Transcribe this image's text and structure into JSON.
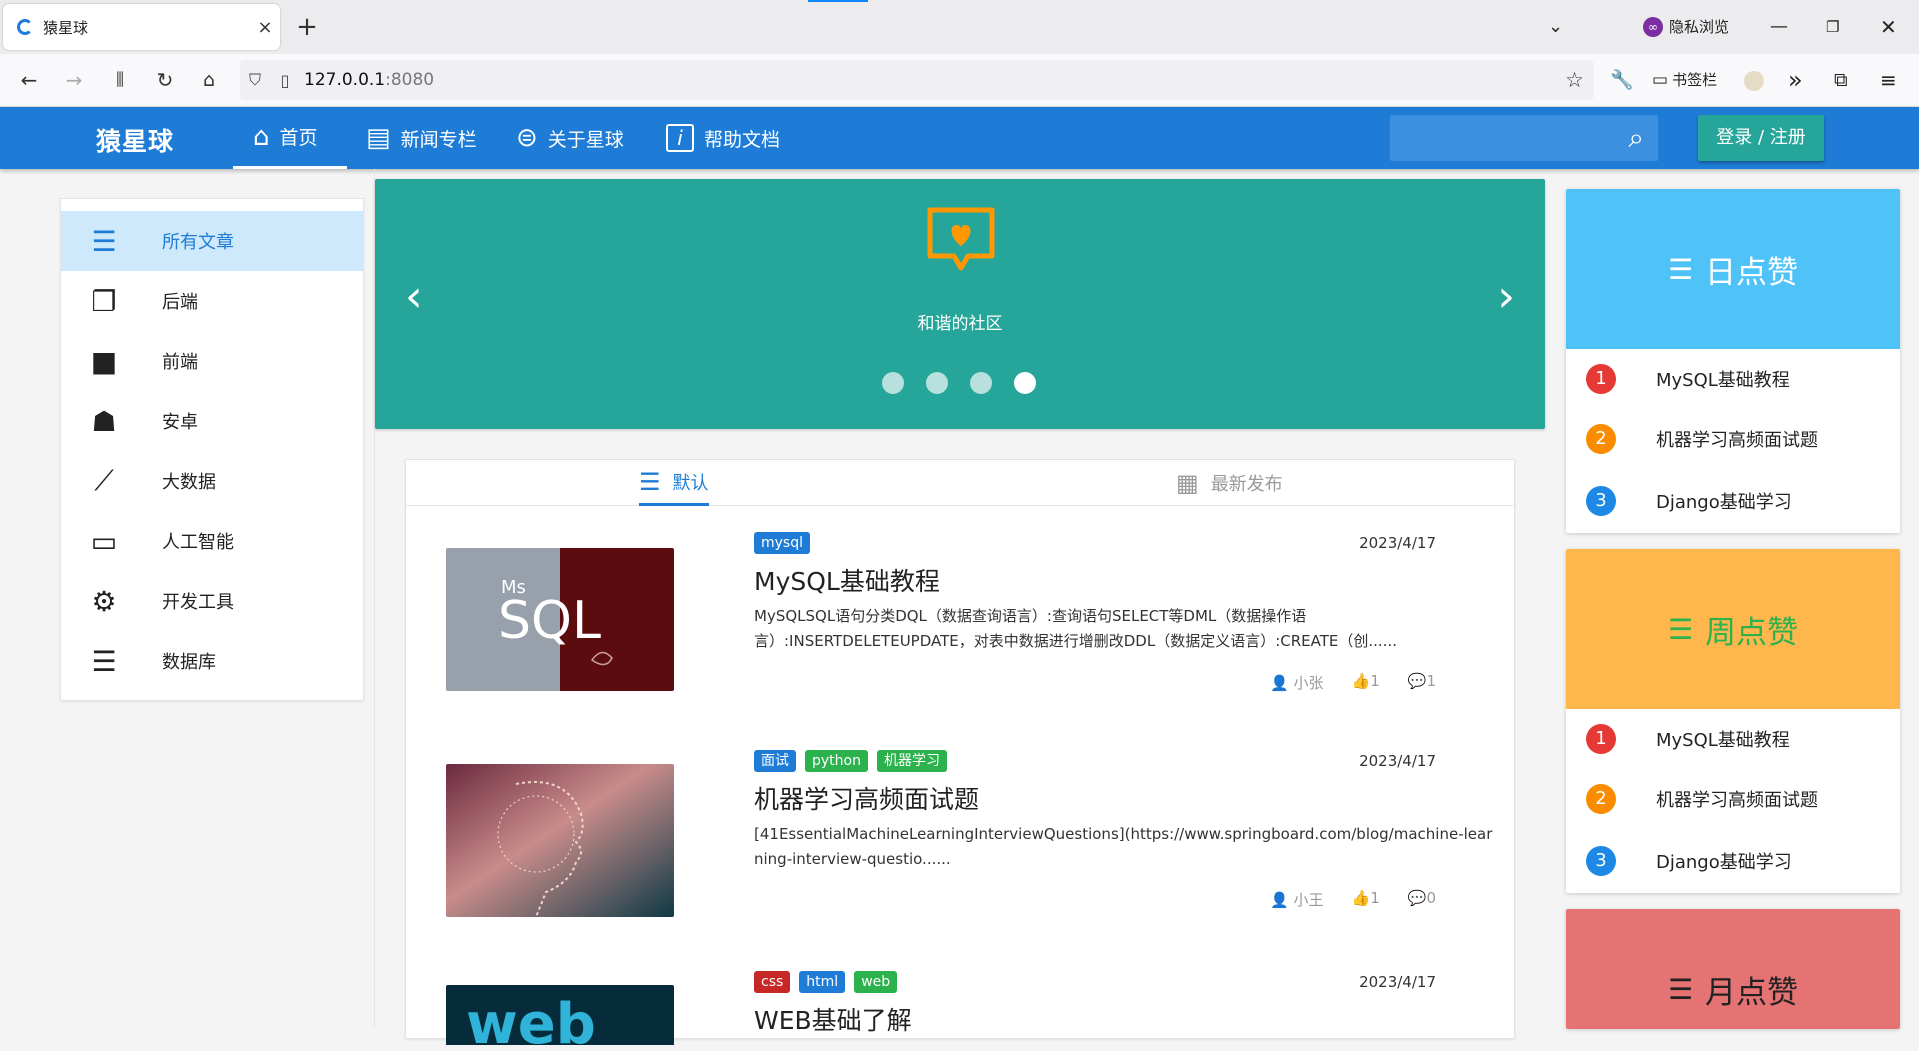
{
  "browser": {
    "tab_title": "猿星球",
    "tab_close": "×",
    "new_tab": "+",
    "private_label": "隐私浏览",
    "url_host": "127.0.0.1",
    "url_port": ":8080",
    "bookmarks_label": "书签栏"
  },
  "site": {
    "logo": "猿星球",
    "nav": [
      {
        "label": "首页",
        "icon": "home-icon"
      },
      {
        "label": "新闻专栏",
        "icon": "newspaper-icon"
      },
      {
        "label": "关于星球",
        "icon": "filter-icon"
      },
      {
        "label": "帮助文档",
        "icon": "info-icon"
      }
    ],
    "login_label": "登录 / 注册",
    "search_placeholder": ""
  },
  "sidebar": {
    "items": [
      {
        "label": "所有文章",
        "icon": "list-icon"
      },
      {
        "label": "后端",
        "icon": "square-stack-icon"
      },
      {
        "label": "前端",
        "icon": "square-stack-filled-icon"
      },
      {
        "label": "安卓",
        "icon": "android-icon"
      },
      {
        "label": "大数据",
        "icon": "line-chart-icon"
      },
      {
        "label": "人工智能",
        "icon": "laptop-icon"
      },
      {
        "label": "开发工具",
        "icon": "gear-icon"
      },
      {
        "label": "数据库",
        "icon": "database-icon"
      }
    ]
  },
  "carousel": {
    "caption": "和谐的社区",
    "dot_count": 4,
    "active_dot": 4,
    "color": "#26a69a"
  },
  "tabs": [
    {
      "label": "默认",
      "icon": "list-icon"
    },
    {
      "label": "最新发布",
      "icon": "calendar-icon"
    }
  ],
  "articles": [
    {
      "tags": [
        {
          "label": "mysql",
          "color": "#1e7cd6"
        }
      ],
      "date": "2023/4/17",
      "title": "MySQL基础教程",
      "desc": "MySQLSQL语句分类DQL（数据查询语言）:查询语句SELECT等DML（数据操作语言）:INSERTDELETEUPDATE，对表中数据进行增删改DDL（数据定义语言）:CREATE（创......",
      "author": "小张",
      "likes": "1",
      "comments": "1"
    },
    {
      "tags": [
        {
          "label": "面试",
          "color": "#1e7cd6"
        },
        {
          "label": "python",
          "color": "#2bb24c"
        },
        {
          "label": "机器学习",
          "color": "#2bb24c"
        }
      ],
      "date": "2023/4/17",
      "title": "机器学习高频面试题",
      "desc": "[41EssentialMachineLearningInterviewQuestions](https://www.springboard.com/blog/machine-learning-interview-questio......",
      "author": "小王",
      "likes": "1",
      "comments": "0"
    },
    {
      "tags": [
        {
          "label": "css",
          "color": "#c62828"
        },
        {
          "label": "html",
          "color": "#1e7cd6"
        },
        {
          "label": "web",
          "color": "#2bb24c"
        }
      ],
      "date": "2023/4/17",
      "title": "WEB基础了解"
    }
  ],
  "rankings": [
    {
      "title": "日点赞",
      "color": "#4fc3f7",
      "text_color": "#ffffff",
      "items": [
        "MySQL基础教程",
        "机器学习高频面试题",
        "Django基础学习"
      ]
    },
    {
      "title": "周点赞",
      "color": "#ffb74d",
      "text_color": "#2bb24c",
      "items": [
        "MySQL基础教程",
        "机器学习高频面试题",
        "Django基础学习"
      ]
    },
    {
      "title": "月点赞",
      "color": "#e57373",
      "text_color": "#222222",
      "items": []
    }
  ],
  "rank_colors": [
    "#e53935",
    "#fb8c00",
    "#1e88e5"
  ]
}
